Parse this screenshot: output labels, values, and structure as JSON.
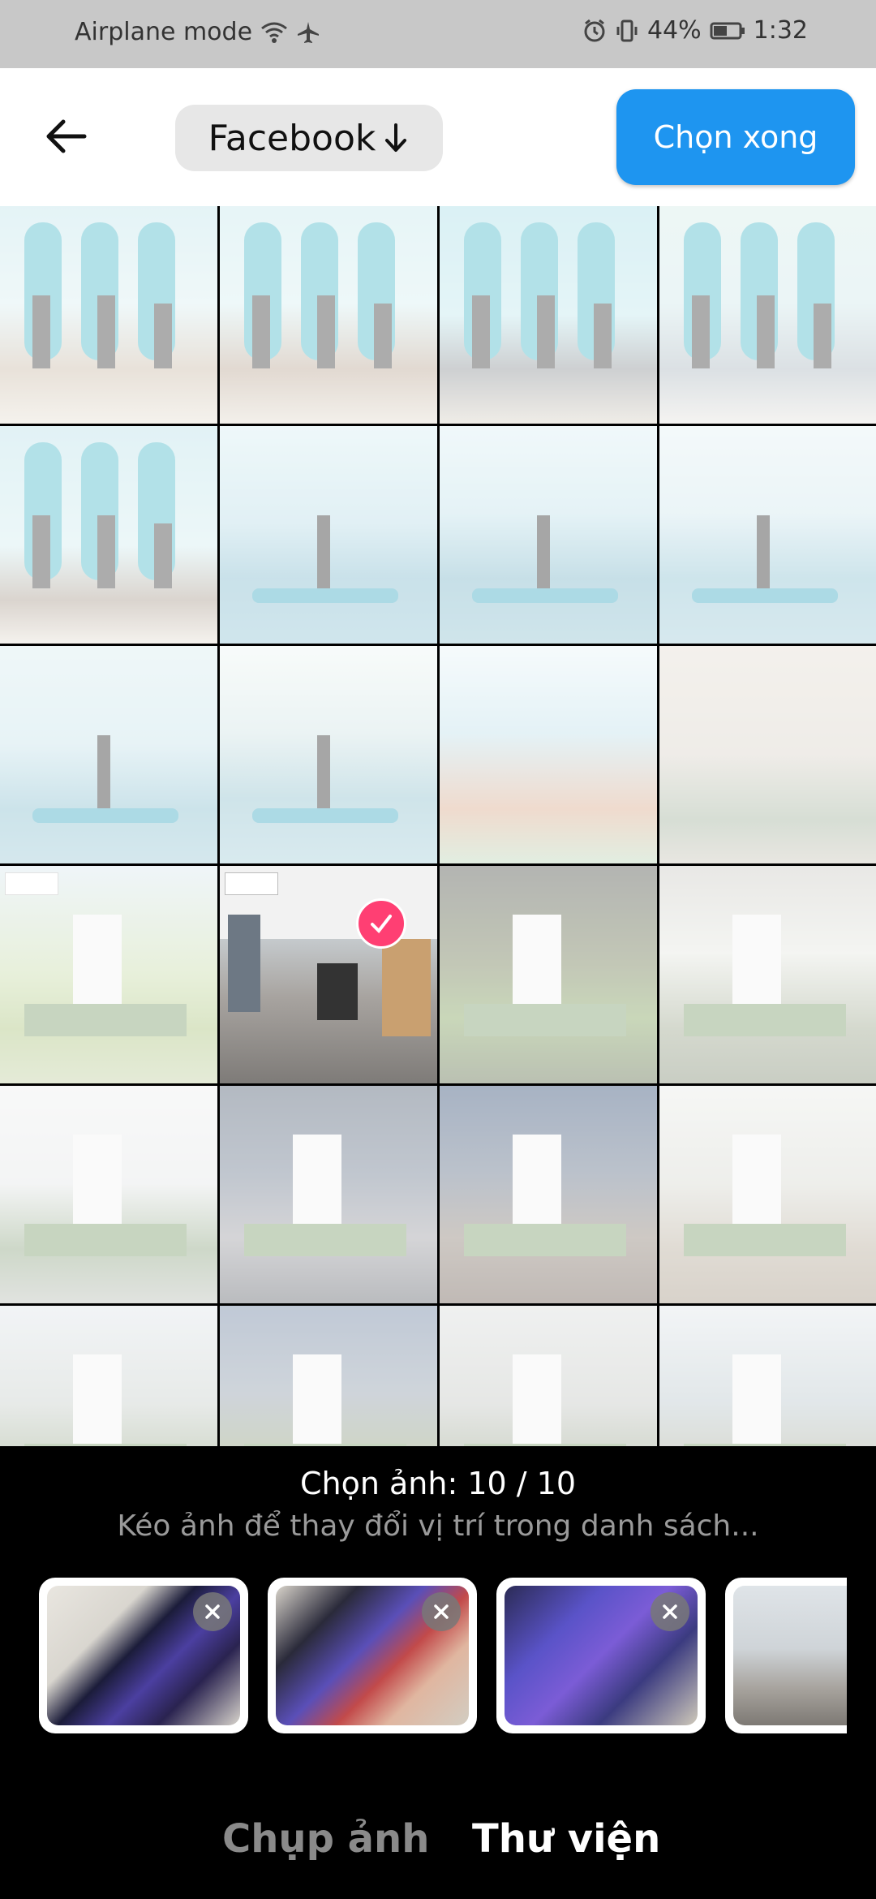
{
  "status_bar": {
    "left_text": "Airplane mode",
    "battery": "44%",
    "time": "1:32"
  },
  "header": {
    "album_label": "Facebook",
    "done_label": "Chọn xong"
  },
  "grid": {
    "cells": [
      {
        "label": "photo-group-paddleboards",
        "bg": "linear-gradient(180deg,#bfe3ea 0%,#d9eef0 45%,#c9b9a6 75%,#e6e0d4 100%)",
        "selected": false
      },
      {
        "label": "photo-group-paddleboards-2",
        "bg": "linear-gradient(180deg,#c5e7ec 0%,#d6eef0 45%,#b9a592 75%,#e2dbcf 100%)",
        "selected": false
      },
      {
        "label": "photo-women-paddleboards",
        "bg": "linear-gradient(180deg,#a8dde6 0%,#bfe6ec 50%,#8a8f93 75%,#d9d3c6 100%)",
        "selected": false
      },
      {
        "label": "photo-woman-boat",
        "bg": "linear-gradient(180deg,#d4ece8 0%,#cfe6e9 45%,#aab6be 75%,#e6e3de 100%)",
        "selected": false
      },
      {
        "label": "photo-man-paddleboards",
        "bg": "linear-gradient(180deg,#b9e0e8 0%,#d2ecef 55%,#a89a8c 80%,#e5dfd5 100%)",
        "selected": false
      },
      {
        "label": "photo-paddling-sea",
        "bg": "linear-gradient(180deg,#d7eef2 0%,#b7dbe6 45%,#7fb8cc 70%,#8fc2d3 100%)",
        "selected": false
      },
      {
        "label": "photo-standing-board",
        "bg": "linear-gradient(180deg,#dceff3 0%,#c0e1ea 40%,#7ab4c7 70%,#8dc0cf 100%)",
        "selected": false
      },
      {
        "label": "photo-kneeling-board",
        "bg": "linear-gradient(180deg,#e4f1f3 0%,#cfe6ed 40%,#8ac0d0 70%,#9fcad7 100%)",
        "selected": false
      },
      {
        "label": "photo-sup-sunset",
        "bg": "linear-gradient(180deg,#d8ecef 0%,#c6e2ea 45%,#86bdcd 75%,#9ac8d5 100%)",
        "selected": false
      },
      {
        "label": "photo-arms-up",
        "bg": "linear-gradient(180deg,#eef5f3 0%,#cfe3e4 40%,#8dbfcc 70%,#a3cdd8 100%)",
        "selected": false
      },
      {
        "label": "photo-race-poster",
        "bg": "linear-gradient(180deg,#e9f4f7 0%,#bfe0ea 40%,#d9a98a 75%,#b9d6b8 100%)",
        "selected": false
      },
      {
        "label": "photo-golf-room",
        "bg": "linear-gradient(180deg,#e4ddd2 0%,#d8d2c8 50%,#9fb09a 80%,#c9c4b8 100%)",
        "selected": false
      },
      {
        "label": "photo-golfer-swing",
        "bg": "linear-gradient(180deg,#d9e7ef 0%,#c7dba8 50%,#a9c27a 75%,#c0cfa1 100%)",
        "selected": false
      },
      {
        "label": "photo-office-lobby",
        "bg": "linear-gradient(180deg,#dde2e6 0%,#c9cfd3 30%,#a8a4a0 60%,#7e7b78 100%)",
        "selected": true
      },
      {
        "label": "photo-golf-trophy",
        "bg": "linear-gradient(180deg,#4b4e48 0%,#6f7a52 45%,#7fa05a 70%,#5b6a48 100%)",
        "selected": false
      },
      {
        "label": "photo-simulator-room",
        "bg": "linear-gradient(180deg,#c9c8c2 0%,#e4e6df 40%,#9aa48a 75%,#7f8a72 100%)",
        "selected": false
      },
      {
        "label": "photo-white-room",
        "bg": "linear-gradient(180deg,#eef0f0 0%,#e3e5e6 45%,#8aa27e 75%,#b7bcb5 100%)",
        "selected": false
      },
      {
        "label": "photo-signing-ceremony",
        "bg": "linear-gradient(180deg,#4b5a6e 0%,#6a788c 40%,#9a9aa0 70%,#5b5f66 100%)",
        "selected": false
      },
      {
        "label": "photo-event-crowd",
        "bg": "linear-gradient(180deg,#2f4a72 0%,#5d6d84 40%,#8a7e72 70%,#6a5a50 100%)",
        "selected": false
      },
      {
        "label": "photo-lakeshore",
        "bg": "linear-gradient(180deg,#e8ebe7 0%,#d6d7cf 45%,#b5aa98 75%,#a39582 100%)",
        "selected": false
      },
      {
        "label": "photo-camping-tents",
        "bg": "linear-gradient(180deg,#dfe5ea 0%,#c6cdc9 45%,#8ea07c 75%,#9aa88a 100%)",
        "selected": false
      },
      {
        "label": "photo-picnic-group",
        "bg": "linear-gradient(180deg,#6a7f9e 0%,#8c9aa8 40%,#8d9c72 70%,#7e8c66 100%)",
        "selected": false
      },
      {
        "label": "photo-bbq-smoke",
        "bg": "linear-gradient(180deg,#d9dcdb 0%,#c3c6c2 45%,#8c9a7e 75%,#96a184 100%)",
        "selected": false
      },
      {
        "label": "photo-beach-tents",
        "bg": "linear-gradient(180deg,#e1e6ea 0%,#b9c6cb 45%,#a3a58f 75%,#b4ac98 100%)",
        "selected": false
      }
    ]
  },
  "panel": {
    "count_text": "Chọn ảnh: 10 / 10",
    "hint_text": "Kéo ảnh để thay đổi vị trí trong danh sách...",
    "tray": [
      {
        "label": "selected-phone-1",
        "bg": "linear-gradient(135deg,#e9e6e0 0%,#d9d6cf 30%,#1b1c3a 45%,#4b3fa0 60%,#2a2350 75%,#d8d4cc 100%)"
      },
      {
        "label": "selected-phone-2",
        "bg": "linear-gradient(135deg,#d9d4cb 0%,#2a2a3a 25%,#5a4fb8 45%,#c24a4a 60%,#e0b6a0 75%,#d2cdc2 100%)"
      },
      {
        "label": "selected-phone-3",
        "bg": "linear-gradient(135deg,#2b2b55 0%,#5a53c8 30%,#7b5cd6 50%,#3b3b80 70%,#cfc9ba 100%)"
      },
      {
        "label": "selected-office",
        "bg": "linear-gradient(180deg,#dfe4e8 0%,#cfd4d8 45%,#a5a19b 75%,#7d7974 100%)"
      }
    ]
  },
  "tabs": {
    "camera_label": "Chụp ảnh",
    "library_label": "Thư viện"
  },
  "colors": {
    "accent": "#1e95f0",
    "selected_badge": "#ff3f73"
  }
}
